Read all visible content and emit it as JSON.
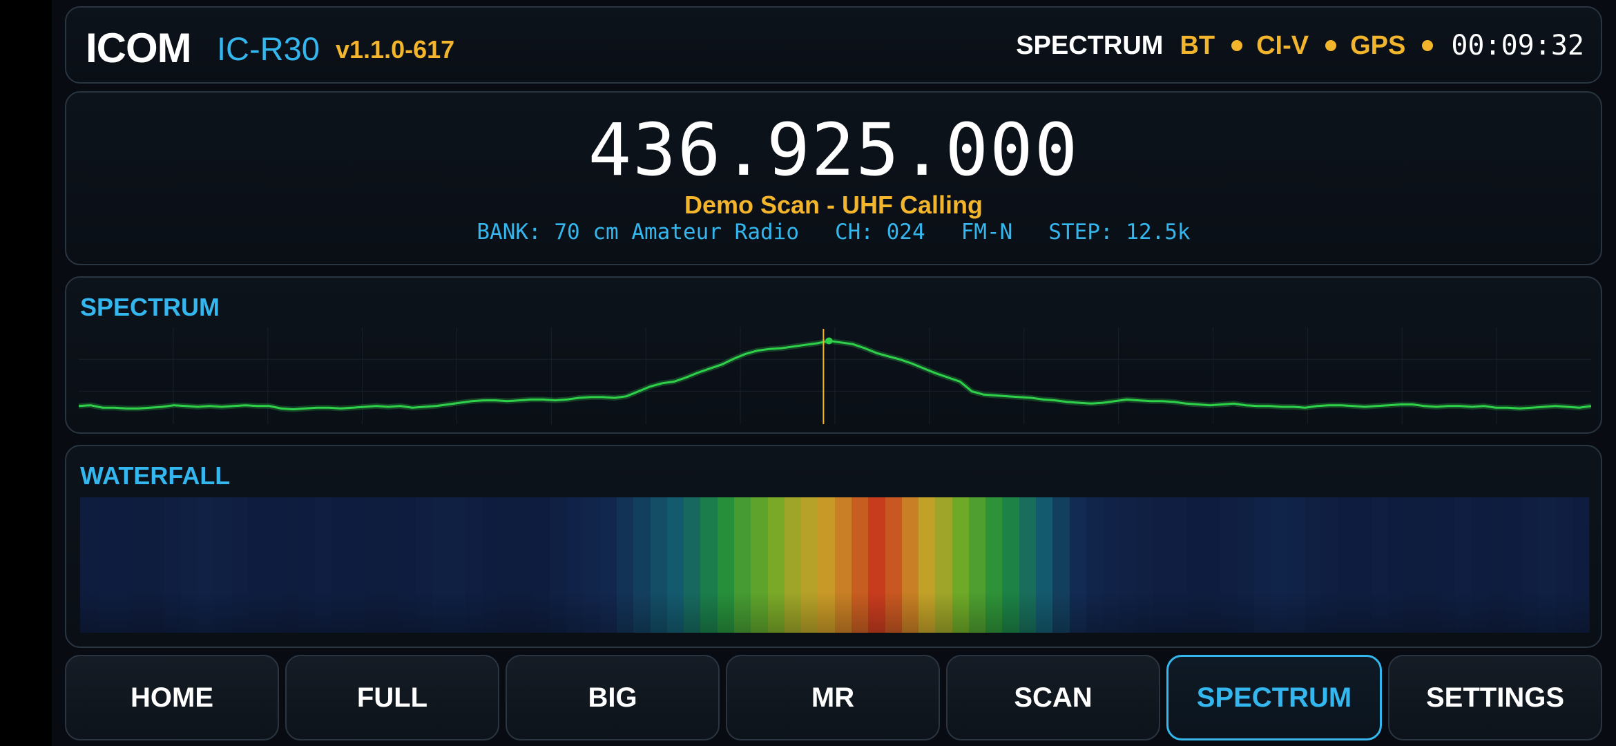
{
  "header": {
    "brand": "ICOM",
    "model": "IC-R30",
    "version": "v1.1.0-617",
    "mode": "SPECTRUM",
    "status_items": [
      "BT",
      "CI-V",
      "GPS"
    ],
    "clock": "00:09:32"
  },
  "radio": {
    "frequency": "436.925.000",
    "channel_name": "Demo Scan - UHF Calling",
    "bank": "BANK: 70 cm Amateur Radio",
    "channel": "CH: 024",
    "modulation": "FM-N",
    "step": "STEP: 12.5k"
  },
  "spectrum": {
    "title": "SPECTRUM",
    "trace_color": "#2fd14a",
    "marker_color": "#f2b52c",
    "trace_levels": [
      0.12,
      0.13,
      0.1,
      0.1,
      0.09,
      0.09,
      0.1,
      0.11,
      0.13,
      0.12,
      0.11,
      0.12,
      0.11,
      0.12,
      0.13,
      0.12,
      0.12,
      0.09,
      0.08,
      0.09,
      0.1,
      0.1,
      0.09,
      0.1,
      0.11,
      0.12,
      0.11,
      0.12,
      0.1,
      0.11,
      0.12,
      0.14,
      0.16,
      0.18,
      0.19,
      0.19,
      0.18,
      0.19,
      0.2,
      0.2,
      0.19,
      0.2,
      0.22,
      0.23,
      0.23,
      0.22,
      0.24,
      0.3,
      0.36,
      0.4,
      0.42,
      0.47,
      0.53,
      0.58,
      0.63,
      0.7,
      0.76,
      0.8,
      0.82,
      0.83,
      0.85,
      0.87,
      0.89,
      0.92,
      0.9,
      0.88,
      0.83,
      0.77,
      0.73,
      0.69,
      0.64,
      0.58,
      0.52,
      0.47,
      0.42,
      0.3,
      0.26,
      0.25,
      0.24,
      0.23,
      0.22,
      0.2,
      0.19,
      0.17,
      0.16,
      0.15,
      0.16,
      0.18,
      0.2,
      0.19,
      0.18,
      0.18,
      0.17,
      0.15,
      0.14,
      0.13,
      0.14,
      0.15,
      0.13,
      0.12,
      0.12,
      0.11,
      0.11,
      0.1,
      0.12,
      0.13,
      0.13,
      0.12,
      0.11,
      0.12,
      0.13,
      0.14,
      0.14,
      0.12,
      0.11,
      0.12,
      0.12,
      0.11,
      0.12,
      0.1,
      0.1,
      0.09,
      0.1,
      0.11,
      0.12,
      0.11,
      0.1,
      0.12
    ]
  },
  "waterfall": {
    "title": "WATERFALL",
    "column_intensity": [
      0.05,
      0.06,
      0.06,
      0.05,
      0.05,
      0.07,
      0.08,
      0.09,
      0.08,
      0.07,
      0.06,
      0.06,
      0.05,
      0.06,
      0.07,
      0.06,
      0.06,
      0.05,
      0.05,
      0.06,
      0.07,
      0.08,
      0.08,
      0.07,
      0.06,
      0.05,
      0.05,
      0.06,
      0.08,
      0.1,
      0.12,
      0.14,
      0.18,
      0.22,
      0.26,
      0.3,
      0.36,
      0.44,
      0.52,
      0.6,
      0.66,
      0.72,
      0.78,
      0.82,
      0.86,
      0.9,
      0.95,
      1.0,
      0.96,
      0.9,
      0.84,
      0.78,
      0.7,
      0.62,
      0.54,
      0.46,
      0.38,
      0.3,
      0.22,
      0.16,
      0.12,
      0.1,
      0.09,
      0.08,
      0.07,
      0.07,
      0.06,
      0.06,
      0.07,
      0.08,
      0.1,
      0.11,
      0.1,
      0.08,
      0.07,
      0.06,
      0.06,
      0.07,
      0.06,
      0.05,
      0.05,
      0.06,
      0.07,
      0.06,
      0.05,
      0.06,
      0.07,
      0.08,
      0.07,
      0.06
    ]
  },
  "nav": {
    "active": "SPECTRUM",
    "items": [
      "HOME",
      "FULL",
      "BIG",
      "MR",
      "SCAN",
      "SPECTRUM",
      "SETTINGS"
    ]
  }
}
